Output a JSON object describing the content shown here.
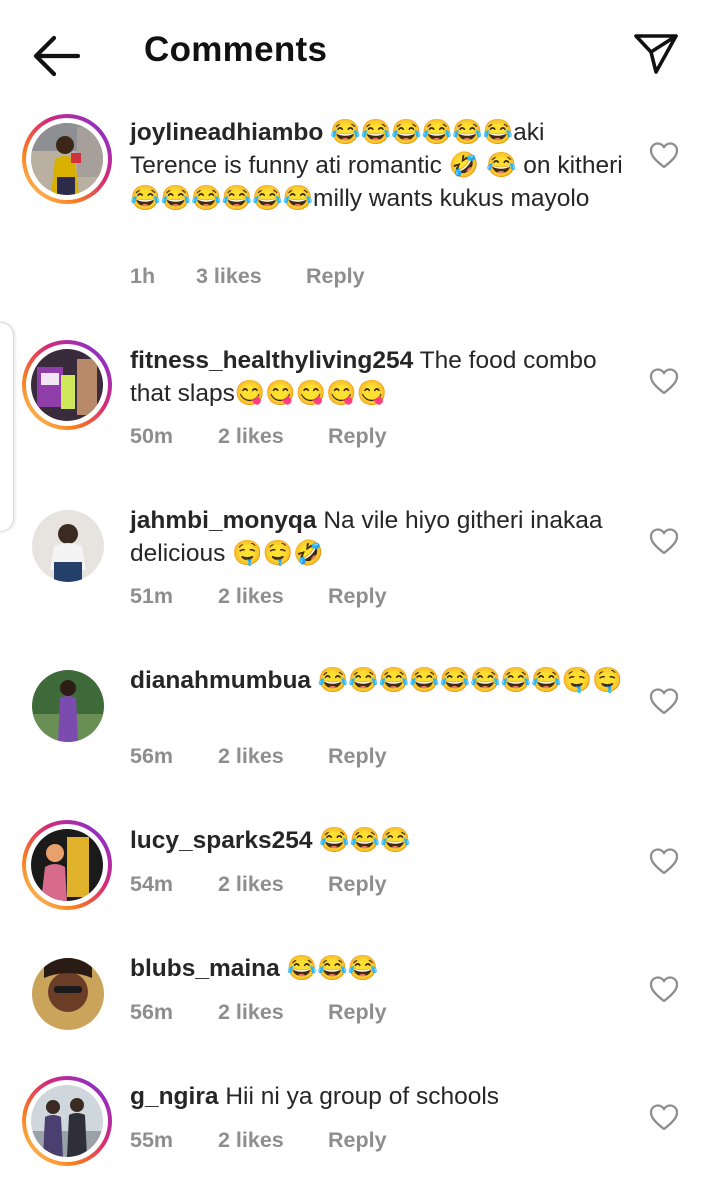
{
  "header": {
    "title": "Comments",
    "back_icon": "arrow-left-icon",
    "send_icon": "paper-plane-icon"
  },
  "comments": [
    {
      "username": "joylineadhiambo",
      "text": "😂😂😂😂😂😂aki Terence is funny ati romantic 🤣 😂 on kitheri 😂😂😂😂😂😂milly wants kukus mayolo",
      "time": "1h",
      "likes": "3 likes",
      "reply": "Reply",
      "story_ring": true
    },
    {
      "username": "fitness_healthyliving254",
      "text": "The food combo that slaps😋😋😋😋😋",
      "time": "50m",
      "likes": "2 likes",
      "reply": "Reply",
      "story_ring": true
    },
    {
      "username": "jahmbi_monyqa",
      "text": "Na vile hiyo githeri inakaa delicious 🤤🤤🤣",
      "time": "51m",
      "likes": "2 likes",
      "reply": "Reply",
      "story_ring": false
    },
    {
      "username": "dianahmumbua",
      "text": "😂😂😂😂😂😂😂😂🤤🤤",
      "time": "56m",
      "likes": "2 likes",
      "reply": "Reply",
      "story_ring": false
    },
    {
      "username": "lucy_sparks254",
      "text": "😂😂😂",
      "time": "54m",
      "likes": "2 likes",
      "reply": "Reply",
      "story_ring": true
    },
    {
      "username": "blubs_maina",
      "text": "😂😂😂",
      "time": "56m",
      "likes": "2 likes",
      "reply": "Reply",
      "story_ring": false
    },
    {
      "username": "g_ngira",
      "text": "Hii ni ya group of schools",
      "time": "55m",
      "likes": "2 likes",
      "reply": "Reply",
      "story_ring": true
    }
  ],
  "colors": {
    "text": "#262626",
    "meta": "#8e8e8e",
    "ring_start": "#feda75",
    "ring_end": "#962fbf"
  }
}
